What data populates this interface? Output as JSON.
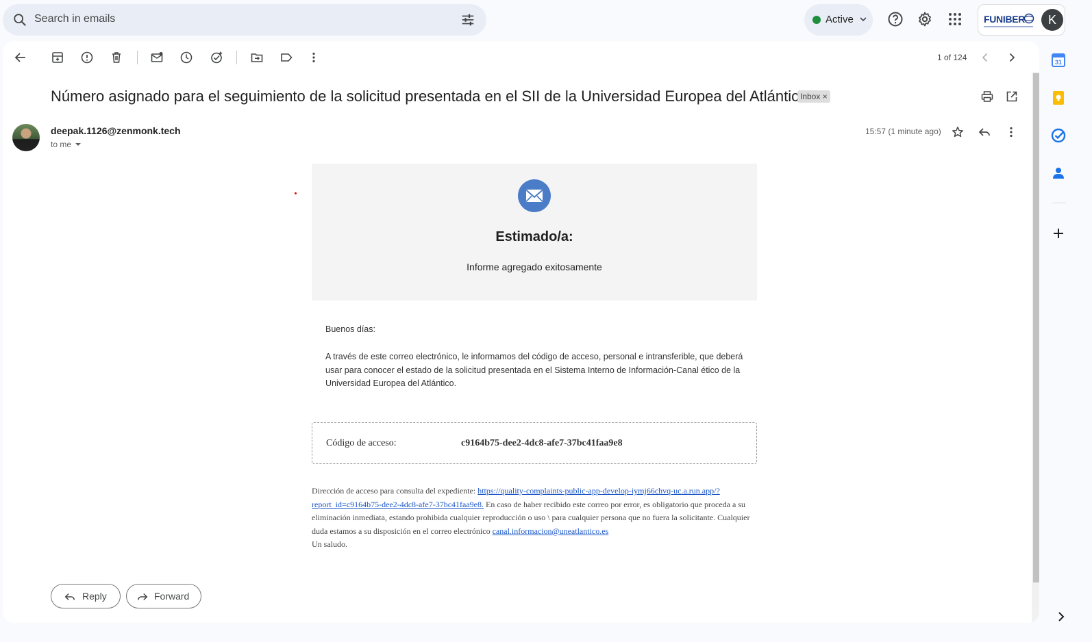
{
  "search": {
    "placeholder": "Search in emails"
  },
  "status": {
    "label": "Active",
    "color": "#1e8e3e"
  },
  "brand": {
    "logo_text": "FUNIBER"
  },
  "account": {
    "initial": "K"
  },
  "toolbar": {
    "counter": "1 of 124"
  },
  "email": {
    "subject": "Número asignado para el seguimiento de la solicitud presentada en el SII de la Universidad Europea del Atlántico",
    "label_chip": "Inbox",
    "sender": "deepak.1126@zenmonk.tech",
    "recipient": "to me",
    "timestamp": "15:57 (1 minute ago)",
    "hero_title": "Estimado/a:",
    "hero_subtitle": "Informe agregado exitosamente",
    "greeting": "Buenos días:",
    "paragraph": "A través de este correo electrónico, le informamos del código de acceso, personal e intransferible, que deberá usar para conocer el estado de la solicitud presentada en el Sistema Interno de Información-Canal ético de la Universidad Europea del Atlántico.",
    "code_label": "Código de acceso:",
    "code_value": "c9164b75-dee2-4dc8-afe7-37bc41faa9e8",
    "footer_prefix": "Dirección de acceso para consulta del expediente: ",
    "footer_link": "https://quality-complaints-public-app-develop-iymj66chvq-uc.a.run.app/?report_id=c9164b75-dee2-4dc8-afe7-37bc41faa9e8.",
    "footer_middle": " En caso de haber recibido este correo por error, es obligatorio que proceda a su eliminación inmediata, estando prohibida cualquier reproducción o uso \\ para cualquier persona que no fuera la solicitante. Cualquier duda estamos a su disposición en el correo electrónico ",
    "footer_email": "canal.informacion@uneatlantico.es",
    "signoff": "Un saludo."
  },
  "actions": {
    "reply": "Reply",
    "forward": "Forward"
  },
  "colors": {
    "accent": "#0b57d0",
    "link": "#1a56c9",
    "hero_icon": "#4a7cc7"
  }
}
